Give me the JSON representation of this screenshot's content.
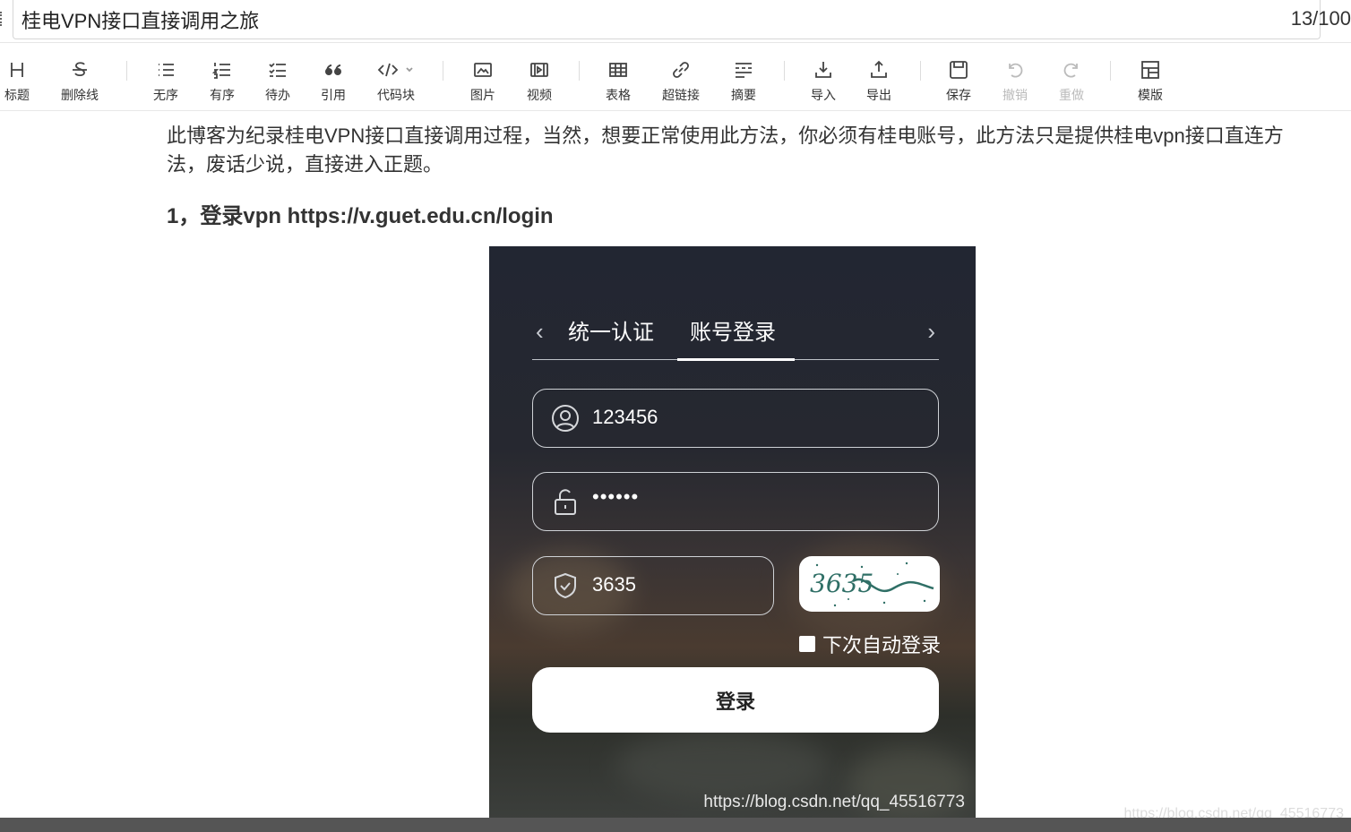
{
  "title": {
    "text": "桂电VPN接口直接调用之旅",
    "count": "13/100"
  },
  "toolbar": [
    {
      "name": "heading",
      "label": "标题",
      "disabled": false
    },
    {
      "name": "strikethrough",
      "label": "删除线",
      "disabled": false
    },
    {
      "name": "unordered-list",
      "label": "无序",
      "disabled": false
    },
    {
      "name": "ordered-list",
      "label": "有序",
      "disabled": false
    },
    {
      "name": "todo-list",
      "label": "待办",
      "disabled": false
    },
    {
      "name": "quote",
      "label": "引用",
      "disabled": false
    },
    {
      "name": "code-block",
      "label": "代码块",
      "disabled": false
    },
    {
      "name": "image",
      "label": "图片",
      "disabled": false
    },
    {
      "name": "video",
      "label": "视频",
      "disabled": false
    },
    {
      "name": "table",
      "label": "表格",
      "disabled": false
    },
    {
      "name": "hyperlink",
      "label": "超链接",
      "disabled": false
    },
    {
      "name": "summary",
      "label": "摘要",
      "disabled": false
    },
    {
      "name": "import",
      "label": "导入",
      "disabled": false
    },
    {
      "name": "export",
      "label": "导出",
      "disabled": false
    },
    {
      "name": "save",
      "label": "保存",
      "disabled": false
    },
    {
      "name": "undo",
      "label": "撤销",
      "disabled": true
    },
    {
      "name": "redo",
      "label": "重做",
      "disabled": true
    },
    {
      "name": "template",
      "label": "模版",
      "disabled": false
    }
  ],
  "content": {
    "paragraph": "此博客为纪录桂电VPN接口直接调用过程，当然，想要正常使用此方法，你必须有桂电账号，此方法只是提供桂电vpn接口直连方法，废话少说，直接进入正题。",
    "heading": "1，登录vpn https://v.guet.edu.cn/login"
  },
  "login_image": {
    "tab_unified": "统一认证",
    "tab_account": "账号登录",
    "username": "123456",
    "password": "••••••",
    "captcha_input": "3635",
    "captcha_image_text": "3635",
    "remember": "下次自动登录",
    "login_button": "登录",
    "watermark": "https://blog.csdn.net/qq_45516773"
  },
  "page_watermark": "https://blog.csdn.net/qq_45516773"
}
